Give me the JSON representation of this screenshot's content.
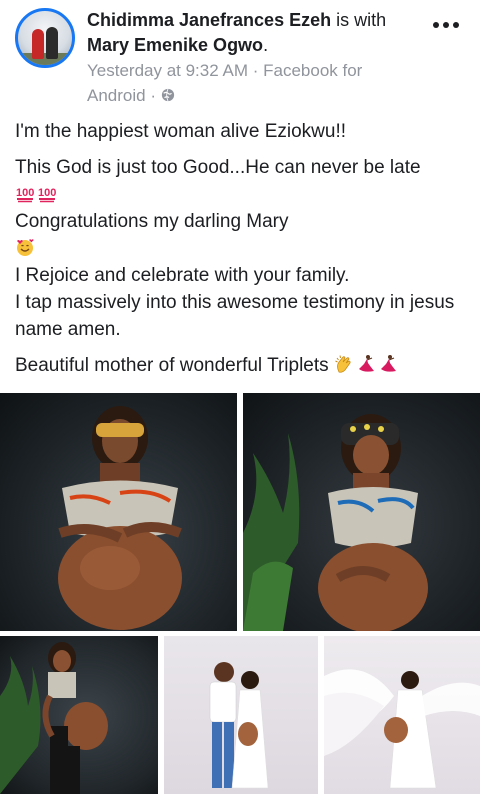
{
  "post": {
    "author": "Chidimma Janefrances Ezeh",
    "with_word": "is with",
    "tagged": "Mary Emenike Ogwo",
    "period": ".",
    "timestamp": "Yesterday at 9:32 AM",
    "separator": "·",
    "source": "Facebook for Android",
    "privacy_icon": "globe-icon",
    "menu_icon": "more-options-icon",
    "text": {
      "line1": "I'm the happiest woman alive Eziokwu!!",
      "line2": "This God is just too Good...He can never be late",
      "line3": "Congratulations my darling Mary",
      "line4": "I Rejoice and celebrate with your family.",
      "line5": "I tap massively into this awesome testimony in jesus name amen.",
      "line6": "Beautiful mother of wonderful Triplets"
    },
    "emojis": {
      "hundred": "hundred-points-icon",
      "smiling_hearts": "smiling-face-with-hearts-icon",
      "clapping": "clapping-hands-icon",
      "dancer": "dancer-icon"
    },
    "photos": [
      "maternity-photo-1",
      "maternity-photo-2",
      "maternity-photo-3",
      "maternity-photo-4",
      "maternity-photo-5"
    ]
  },
  "colors": {
    "accent": "#1877f2",
    "text": "#1c1e21",
    "meta": "#90949c",
    "hundred": "#e0245e"
  }
}
